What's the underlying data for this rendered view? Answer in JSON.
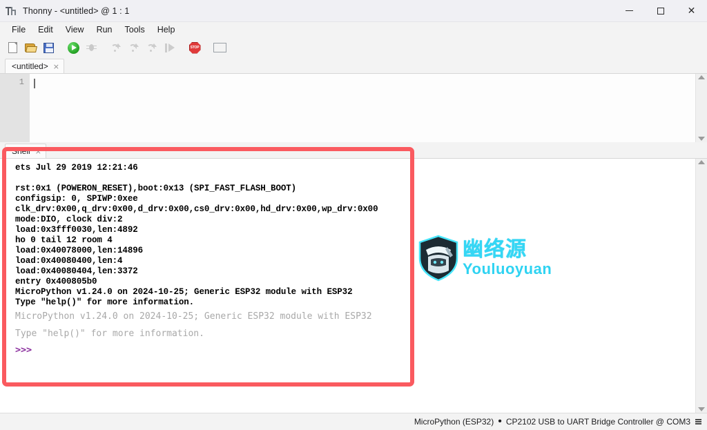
{
  "window": {
    "title": "Thonny  -  <untitled>  @  1 : 1",
    "icon": "thonny-logo-icon",
    "controls": {
      "minimize": "—",
      "maximize": "□",
      "close": "✕"
    }
  },
  "menubar": {
    "items": [
      {
        "label": "File"
      },
      {
        "label": "Edit"
      },
      {
        "label": "View"
      },
      {
        "label": "Run"
      },
      {
        "label": "Tools"
      },
      {
        "label": "Help"
      }
    ]
  },
  "toolbar": {
    "buttons": [
      {
        "name": "new-file",
        "title": "New",
        "enabled": true
      },
      {
        "name": "open-file",
        "title": "Open",
        "enabled": true
      },
      {
        "name": "save-file",
        "title": "Save",
        "enabled": true
      },
      {
        "name": "run-script",
        "title": "Run current script",
        "enabled": true
      },
      {
        "name": "debug-script",
        "title": "Debug current script",
        "enabled": false
      },
      {
        "name": "step-over",
        "title": "Step over",
        "enabled": false
      },
      {
        "name": "step-into",
        "title": "Step into",
        "enabled": false
      },
      {
        "name": "step-out",
        "title": "Step out",
        "enabled": false
      },
      {
        "name": "resume",
        "title": "Resume",
        "enabled": false
      },
      {
        "name": "stop",
        "title": "Stop/Restart backend",
        "enabled": true
      },
      {
        "name": "support-ukraine",
        "title": "Support Ukraine",
        "enabled": true
      }
    ],
    "stop_label": "STOP"
  },
  "editor": {
    "tab": {
      "label": "<untitled>",
      "close": "×"
    },
    "line_numbers": [
      "1"
    ],
    "lines": [
      ""
    ]
  },
  "shell": {
    "tab": {
      "label": "Shell",
      "close": "×"
    },
    "lines": [
      {
        "text": "ets Jul 29 2019 12:21:46",
        "style": "mono"
      },
      {
        "text": " ",
        "style": "blank"
      },
      {
        "text": "rst:0x1 (POWERON_RESET),boot:0x13 (SPI_FAST_FLASH_BOOT)",
        "style": "mono"
      },
      {
        "text": "configsip: 0, SPIWP:0xee",
        "style": "mono"
      },
      {
        "text": "clk_drv:0x00,q_drv:0x00,d_drv:0x00,cs0_drv:0x00,hd_drv:0x00,wp_drv:0x00",
        "style": "mono"
      },
      {
        "text": "mode:DIO, clock div:2",
        "style": "mono"
      },
      {
        "text": "load:0x3fff0030,len:4892",
        "style": "mono"
      },
      {
        "text": "ho 0 tail 12 room 4",
        "style": "mono"
      },
      {
        "text": "load:0x40078000,len:14896",
        "style": "mono"
      },
      {
        "text": "load:0x40080400,len:4",
        "style": "mono"
      },
      {
        "text": "load:0x40080404,len:3372",
        "style": "mono"
      },
      {
        "text": "entry 0x400805b0",
        "style": "mono"
      },
      {
        "text": "MicroPython v1.24.0 on 2024-10-25; Generic ESP32 module with ESP32",
        "style": "mono"
      },
      {
        "text": "Type \"help()\" for more information.",
        "style": "mono"
      },
      {
        "text": "MicroPython v1.24.0 on 2024-10-25; Generic ESP32 module with ESP32",
        "style": "banner"
      },
      {
        "text": "Type \"help()\" for more information.",
        "style": "banner"
      },
      {
        "text": ">>>",
        "style": "prompt"
      }
    ]
  },
  "annotation": {
    "shape": "rectangle-highlight",
    "color": "#fa5a5f"
  },
  "watermark": {
    "chinese": "幽络源",
    "english": "Youluoyuan",
    "color": "#34d7f5"
  },
  "statusbar": {
    "interpreter": "MicroPython (ESP32)",
    "separator": "•",
    "device": "CP2102 USB to UART Bridge Controller @ COM3"
  }
}
